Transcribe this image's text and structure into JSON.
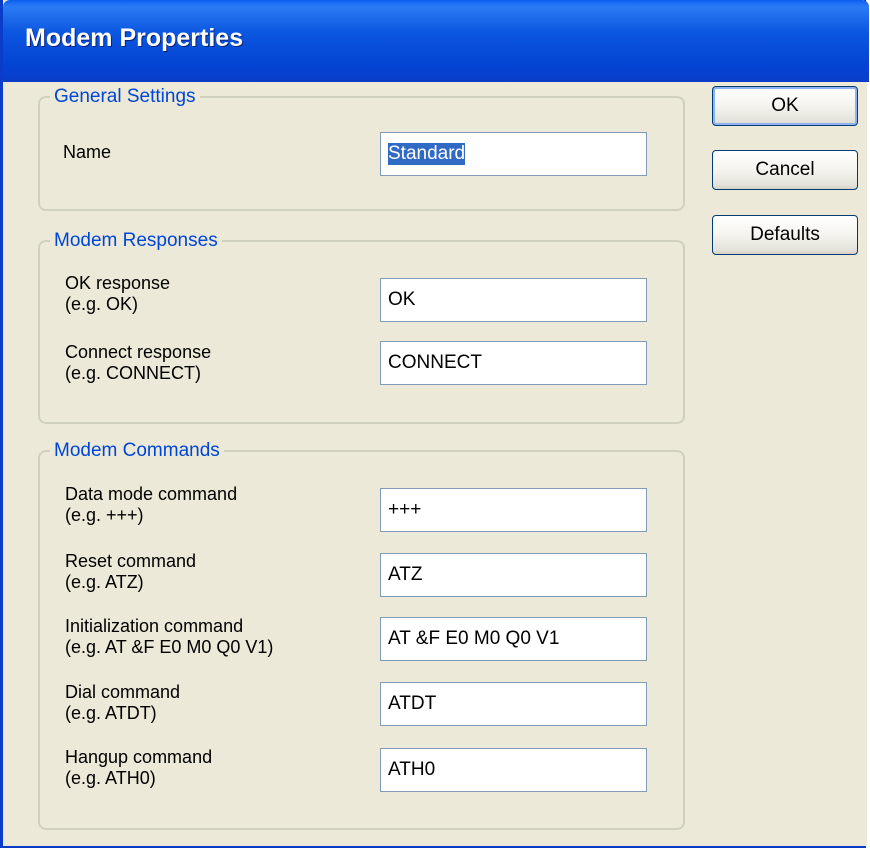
{
  "window": {
    "title": "Modem Properties"
  },
  "buttons": {
    "ok": "OK",
    "cancel": "Cancel",
    "defaults": "Defaults"
  },
  "general": {
    "legend": "General Settings",
    "name_label": "Name",
    "name_value": "Standard"
  },
  "responses": {
    "legend": "Modem Responses",
    "ok_label_line1": "OK response",
    "ok_label_line2": "(e.g. OK)",
    "ok_value": "OK",
    "connect_label_line1": "Connect response",
    "connect_label_line2": "(e.g. CONNECT)",
    "connect_value": "CONNECT"
  },
  "commands": {
    "legend": "Modem Commands",
    "data_mode_line1": "Data mode command",
    "data_mode_line2": "(e.g. +++)",
    "data_mode_value": "+++",
    "reset_line1": "Reset command",
    "reset_line2": "(e.g. ATZ)",
    "reset_value": "ATZ",
    "init_line1": "Initialization command",
    "init_line2": "(e.g. AT &F E0 M0 Q0 V1)",
    "init_value": "AT &F E0 M0 Q0 V1",
    "dial_line1": "Dial command",
    "dial_line2": "(e.g. ATDT)",
    "dial_value": "ATDT",
    "hangup_line1": "Hangup command",
    "hangup_line2": "(e.g. ATH0)",
    "hangup_value": "ATH0"
  }
}
